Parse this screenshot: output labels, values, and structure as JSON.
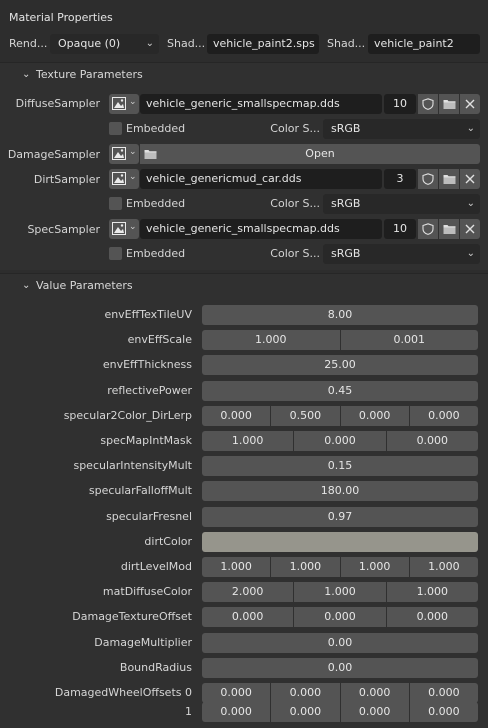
{
  "panel": {
    "title": "Material Properties",
    "render_label": "Rend...",
    "render_value": "Opaque (0)",
    "shader_label_1": "Shad...",
    "shader_value_1": "vehicle_paint2.sps",
    "shader_label_2": "Shad...",
    "shader_value_2": "vehicle_paint2"
  },
  "texture_section": {
    "title": "Texture Parameters",
    "samplers": [
      {
        "label": "DiffuseSampler",
        "file": "vehicle_generic_smallspecmap.dds",
        "number": "10",
        "embedded_label": "Embedded",
        "colorspace_label": "Color S...",
        "colorspace": "sRGB"
      },
      {
        "label": "DamageSampler",
        "open_label": "Open"
      },
      {
        "label": "DirtSampler",
        "file": "vehicle_genericmud_car.dds",
        "number": "3",
        "embedded_label": "Embedded",
        "colorspace_label": "Color S...",
        "colorspace": "sRGB"
      },
      {
        "label": "SpecSampler",
        "file": "vehicle_generic_smallspecmap.dds",
        "number": "10",
        "embedded_label": "Embedded",
        "colorspace_label": "Color S...",
        "colorspace": "sRGB"
      }
    ]
  },
  "value_section": {
    "title": "Value Parameters",
    "params": [
      {
        "label": "envEffTexTileUV",
        "values": [
          "8.00"
        ]
      },
      {
        "label": "envEffScale",
        "values": [
          "1.000",
          "0.001"
        ]
      },
      {
        "label": "envEffThickness",
        "values": [
          "25.00"
        ]
      },
      {
        "label": "reflectivePower",
        "values": [
          "0.45"
        ]
      },
      {
        "label": "specular2Color_DirLerp",
        "values": [
          "0.000",
          "0.500",
          "0.000",
          "0.000"
        ]
      },
      {
        "label": "specMapIntMask",
        "values": [
          "1.000",
          "0.000",
          "0.000"
        ]
      },
      {
        "label": "specularIntensityMult",
        "values": [
          "0.15"
        ]
      },
      {
        "label": "specularFalloffMult",
        "values": [
          "180.00"
        ]
      },
      {
        "label": "specularFresnel",
        "values": [
          "0.97"
        ]
      },
      {
        "label": "dirtColor",
        "color": "#96958c"
      },
      {
        "label": "dirtLevelMod",
        "values": [
          "1.000",
          "1.000",
          "1.000",
          "1.000"
        ]
      },
      {
        "label": "matDiffuseColor",
        "values": [
          "2.000",
          "1.000",
          "1.000"
        ]
      },
      {
        "label": "DamageTextureOffset",
        "values": [
          "0.000",
          "0.000",
          "0.000"
        ]
      },
      {
        "label": "DamageMultiplier",
        "values": [
          "0.00"
        ]
      },
      {
        "label": "BoundRadius",
        "values": [
          "0.00"
        ]
      },
      {
        "label": "DamagedWheelOffsets 0",
        "values": [
          "0.000",
          "0.000",
          "0.000",
          "0.000"
        ]
      },
      {
        "label": "1",
        "values": [
          "0.000",
          "0.000",
          "0.000",
          "0.000"
        ]
      }
    ]
  }
}
